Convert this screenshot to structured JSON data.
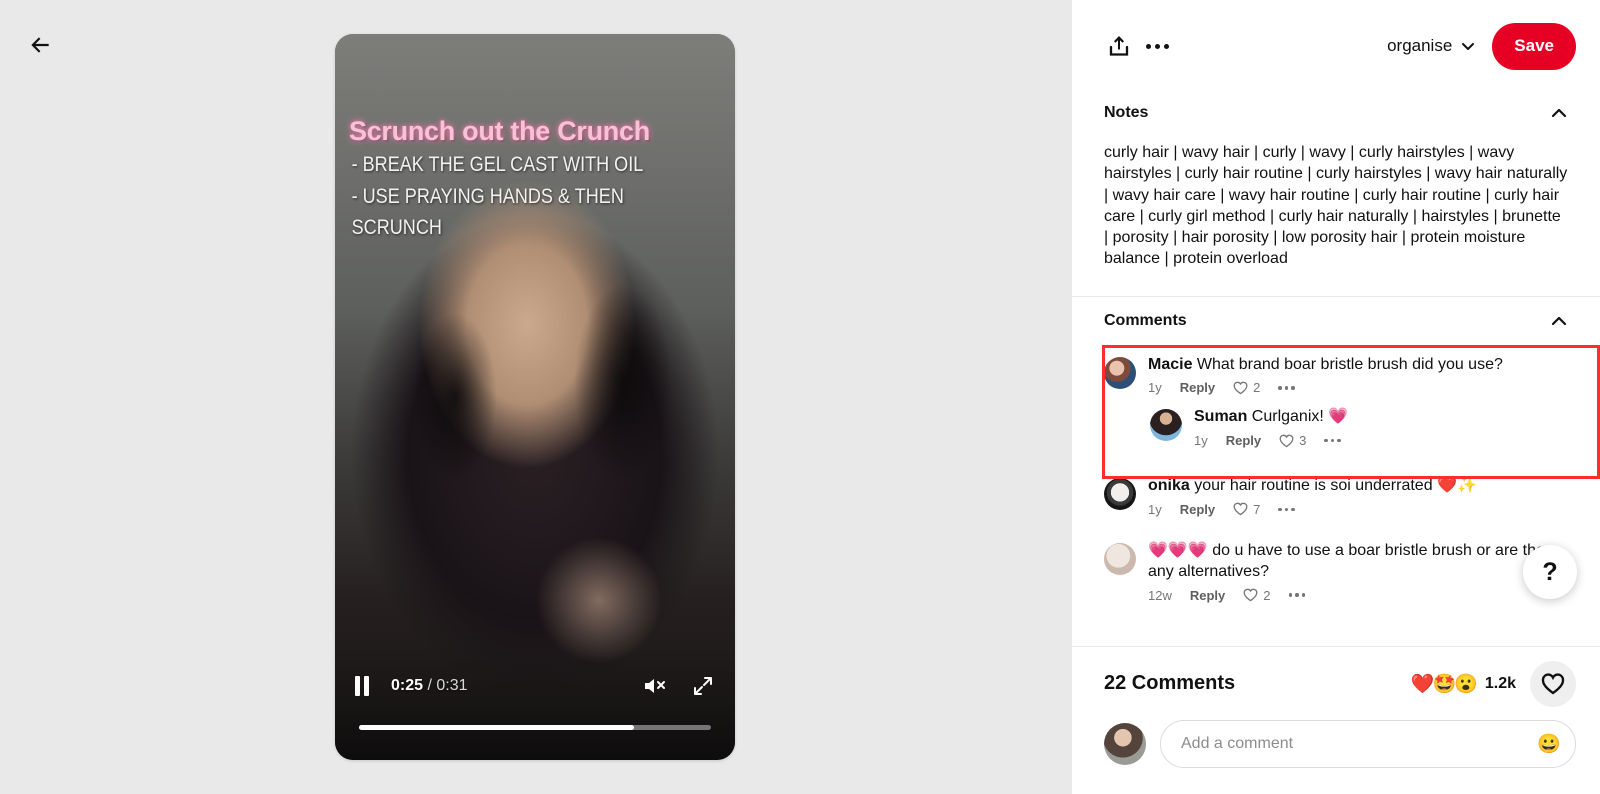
{
  "left": {
    "back_icon": "arrow-left-icon",
    "video": {
      "overlay_title": "Scrunch out the Crunch",
      "overlay_lines": [
        "- BREAK THE GEL CAST WITH OIL",
        "- USE PRAYING HANDS & THEN",
        "SCRUNCH"
      ],
      "current_time": "0:25",
      "total_time": "0:31",
      "time_separator": "/",
      "progress_percent": 78,
      "pause_icon": "pause-icon",
      "mute_icon": "volume-muted-icon",
      "fullscreen_icon": "fullscreen-icon"
    }
  },
  "topbar": {
    "share_icon": "share-upload-icon",
    "more_icon": "more-horizontal-icon",
    "organise_label": "organise",
    "organise_chevron": "chevron-down-icon",
    "save_label": "Save",
    "save_color": "#e60023"
  },
  "notes": {
    "title": "Notes",
    "collapse_icon": "chevron-up-icon",
    "body": "curly hair | wavy hair | curly | wavy | curly hairstyles | wavy hairstyles | curly hair routine | curly hairstyles | wavy hair naturally | wavy hair care | wavy hair routine | curly hair routine | curly hair care | curly girl method | curly hair naturally | hairstyles | brunette | porosity | hair porosity | low porosity hair | protein moisture balance | protein overload"
  },
  "comments": {
    "title": "Comments",
    "collapse_icon": "chevron-up-icon",
    "highlight_color": "#ff2d2d",
    "items": [
      {
        "username": "Macie",
        "text": "What brand boar bristle brush did you use?",
        "time": "1y",
        "reply_label": "Reply",
        "like_count": "2",
        "more_icon": "more-horizontal-icon",
        "avatar": "av1",
        "highlighted": true,
        "reply": {
          "username": "Suman",
          "text": "Curlganix! 💗",
          "time": "1y",
          "reply_label": "Reply",
          "like_count": "3",
          "more_icon": "more-horizontal-icon",
          "avatar": "av2"
        }
      },
      {
        "username": "onika",
        "text": "your hair routine is soi underrated ❤️✨",
        "time": "1y",
        "reply_label": "Reply",
        "like_count": "7",
        "more_icon": "more-horizontal-icon",
        "avatar": "av3"
      },
      {
        "username": "💗💗💗",
        "text": "do u have to use a boar bristle brush or are there any alternatives?",
        "time": "12w",
        "reply_label": "Reply",
        "like_count": "2",
        "more_icon": "more-horizontal-icon",
        "avatar": "av4"
      }
    ]
  },
  "help": {
    "label": "?",
    "icon": "question-mark-icon"
  },
  "footer": {
    "comment_count": "22 Comments",
    "reactions_emoji": "❤️🤩😮",
    "reactions_count": "1.2k",
    "heart_icon": "heart-outline-icon",
    "composer_placeholder": "Add a comment",
    "composer_value": "",
    "emoji_icon": "smiley-icon",
    "user_avatar": "av5"
  }
}
